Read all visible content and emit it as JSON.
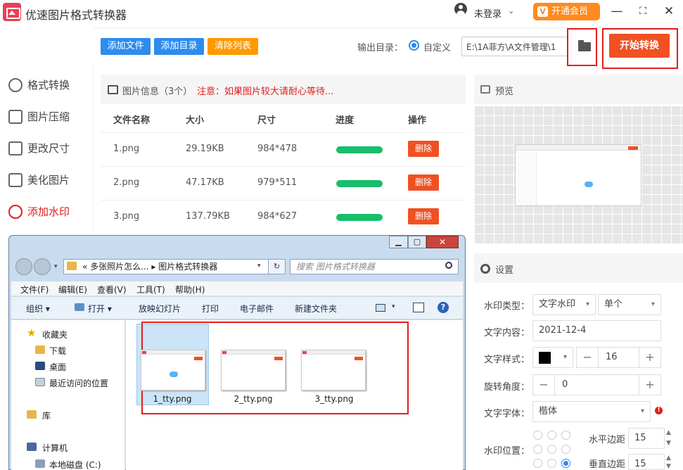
{
  "app": {
    "title": "优速图片格式转换器",
    "login": "未登录",
    "vip": "开通会员",
    "vip_icon": "V"
  },
  "window_controls": {
    "minimize": "—",
    "maximize": "⛶",
    "close": "✕"
  },
  "toolbar": {
    "add_file": "添加文件",
    "add_dir": "添加目录",
    "clear_list": "清除列表",
    "output_label": "输出目录：",
    "output_option": "自定义",
    "output_path": "E:\\1A菲方\\A文件管理\\1",
    "start": "开始转换"
  },
  "sidebar": {
    "items": [
      {
        "label": "格式转换",
        "icon": "convert-icon"
      },
      {
        "label": "图片压缩",
        "icon": "compress-icon"
      },
      {
        "label": "更改尺寸",
        "icon": "resize-icon"
      },
      {
        "label": "美化图片",
        "icon": "beautify-icon"
      },
      {
        "label": "添加水印",
        "icon": "watermark-icon"
      }
    ]
  },
  "file_panel": {
    "info": "图片信息（3个）",
    "note": "注意：如果图片较大请耐心等待...",
    "columns": [
      "文件名称",
      "大小",
      "尺寸",
      "进度",
      "操作"
    ],
    "rows": [
      {
        "name": "1.png",
        "size": "29.19KB",
        "dims": "984*478",
        "progress": 1.0,
        "action": "删除"
      },
      {
        "name": "2.png",
        "size": "47.17KB",
        "dims": "979*511",
        "progress": 1.0,
        "action": "删除"
      },
      {
        "name": "3.png",
        "size": "137.79KB",
        "dims": "984*627",
        "progress": 1.0,
        "action": "删除"
      }
    ]
  },
  "preview": {
    "label": "预览"
  },
  "settings": {
    "label": "设置",
    "type_label": "水印类型：",
    "type_value": "文字水印",
    "count_value": "单个",
    "content_label": "文字内容：",
    "content_value": "2021-12-4",
    "style_label": "文字样式：",
    "color": "#000000",
    "font_size": "16",
    "rotate_label": "旋转角度：",
    "rotate_value": "0",
    "font_label": "文字字体：",
    "font_value": "楷体",
    "warn": "!",
    "position_label": "水印位置：",
    "hmargin_label": "水平边距",
    "hmargin_value": "15",
    "vmargin_label": "垂直边距",
    "vmargin_value": "15"
  },
  "explorer": {
    "address": "«  多张照片怎么...  ▸  图片格式转换器",
    "search_placeholder": "搜索 图片格式转换器",
    "menu": [
      "文件(F)",
      "编辑(E)",
      "查看(V)",
      "工具(T)",
      "帮助(H)"
    ],
    "commands": [
      "组织 ▾",
      "打开 ▾",
      "放映幻灯片",
      "打印",
      "电子邮件",
      "新建文件夹"
    ],
    "nav": [
      {
        "label": "收藏夹"
      },
      {
        "label": "下载"
      },
      {
        "label": "桌面"
      },
      {
        "label": "最近访问的位置"
      },
      {
        "label": "库"
      },
      {
        "label": "计算机"
      },
      {
        "label": "本地磁盘 (C:)"
      }
    ],
    "files": [
      "1_tty.png",
      "2_tty.png",
      "3_tty.png"
    ]
  }
}
